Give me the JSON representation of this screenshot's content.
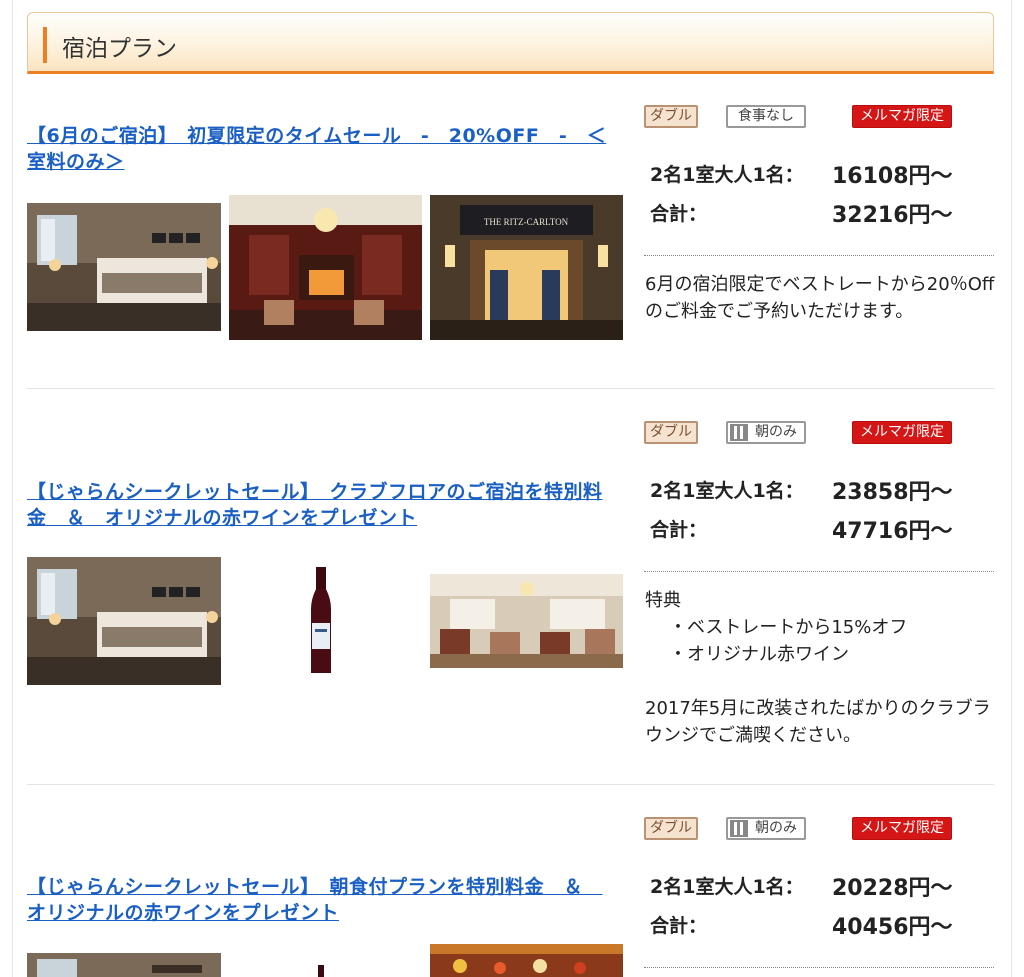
{
  "section": {
    "title": "宿泊プラン"
  },
  "plans": [
    {
      "title": "【6月のご宿泊】　初夏限定のタイムセール　-　20%OFF　-　＜室料のみ＞",
      "tags": {
        "room": "ダブル",
        "meal": "食事なし",
        "meal_icon": "",
        "mail": "メルマガ限定"
      },
      "price_label": "2名1室大人1名：",
      "price_value": "16108円〜",
      "total_label": "合計：",
      "total_value": "32216円〜",
      "description": "6月の宿泊限定でベストレートから20％Offのご料金でご予約いただけます。"
    },
    {
      "title": "【じゃらんシークレットセール】　クラブフロアのご宿泊を特別料金　＆　オリジナルの赤ワインをプレゼント",
      "tags": {
        "room": "ダブル",
        "meal": "朝のみ",
        "meal_icon": "fork-knife-icon",
        "mail": "メルマガ限定"
      },
      "price_label": "2名1室大人1名：",
      "price_value": "23858円〜",
      "total_label": "合計：",
      "total_value": "47716円〜",
      "description_lines": [
        "特典",
        "・ベストレートから15%オフ",
        "・オリジナル赤ワイン",
        "",
        "2017年5月に改装されたばかりのクラブラウンジでご満喫ください。"
      ]
    },
    {
      "title": "【じゃらんシークレットセール】　朝食付プランを特別料金　＆　オリジナルの赤ワインをプレゼント",
      "tags": {
        "room": "ダブル",
        "meal": "朝のみ",
        "meal_icon": "fork-knife-icon",
        "mail": "メルマガ限定"
      },
      "price_label": "2名1室大人1名：",
      "price_value": "20228円〜",
      "total_label": "合計：",
      "total_value": "40456円〜"
    }
  ],
  "photos": {
    "entrance_sign": "THE RITZ-CARLTON"
  },
  "colors": {
    "link": "#1a5fc4",
    "accent": "#ee7e22",
    "mail_badge": "#d41716"
  }
}
